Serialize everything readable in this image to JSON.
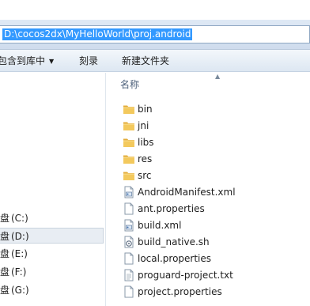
{
  "address": {
    "path": "D:\\cocos2dx\\MyHelloWorld\\proj.android"
  },
  "toolbar": {
    "include_in_library": "包含到库中",
    "burn": "刻录",
    "new_folder": "新建文件夹"
  },
  "nav": {
    "items": [
      {
        "prefix": "盘",
        "label": "(C:)"
      },
      {
        "prefix": "盘",
        "label": "(D:)"
      },
      {
        "prefix": "盘",
        "label": "(E:)"
      },
      {
        "prefix": "盘",
        "label": "(F:)"
      },
      {
        "prefix": "盘",
        "label": "(G:)"
      }
    ],
    "selected": "(D:)"
  },
  "list": {
    "column_name": "名称",
    "files": [
      {
        "name": "bin",
        "icon": "folder-icon"
      },
      {
        "name": "jni",
        "icon": "folder-icon"
      },
      {
        "name": "libs",
        "icon": "folder-icon"
      },
      {
        "name": "res",
        "icon": "folder-icon"
      },
      {
        "name": "src",
        "icon": "folder-icon"
      },
      {
        "name": "AndroidManifest.xml",
        "icon": "xml-file-icon"
      },
      {
        "name": "ant.properties",
        "icon": "document-icon"
      },
      {
        "name": "build.xml",
        "icon": "xml-file-icon"
      },
      {
        "name": "build_native.sh",
        "icon": "script-file-icon"
      },
      {
        "name": "local.properties",
        "icon": "document-icon"
      },
      {
        "name": "proguard-project.txt",
        "icon": "text-file-icon"
      },
      {
        "name": "project.properties",
        "icon": "document-icon"
      }
    ]
  },
  "colors": {
    "selection": "#3399ff",
    "folder": "#f0c653",
    "header_text": "#4c607a"
  }
}
